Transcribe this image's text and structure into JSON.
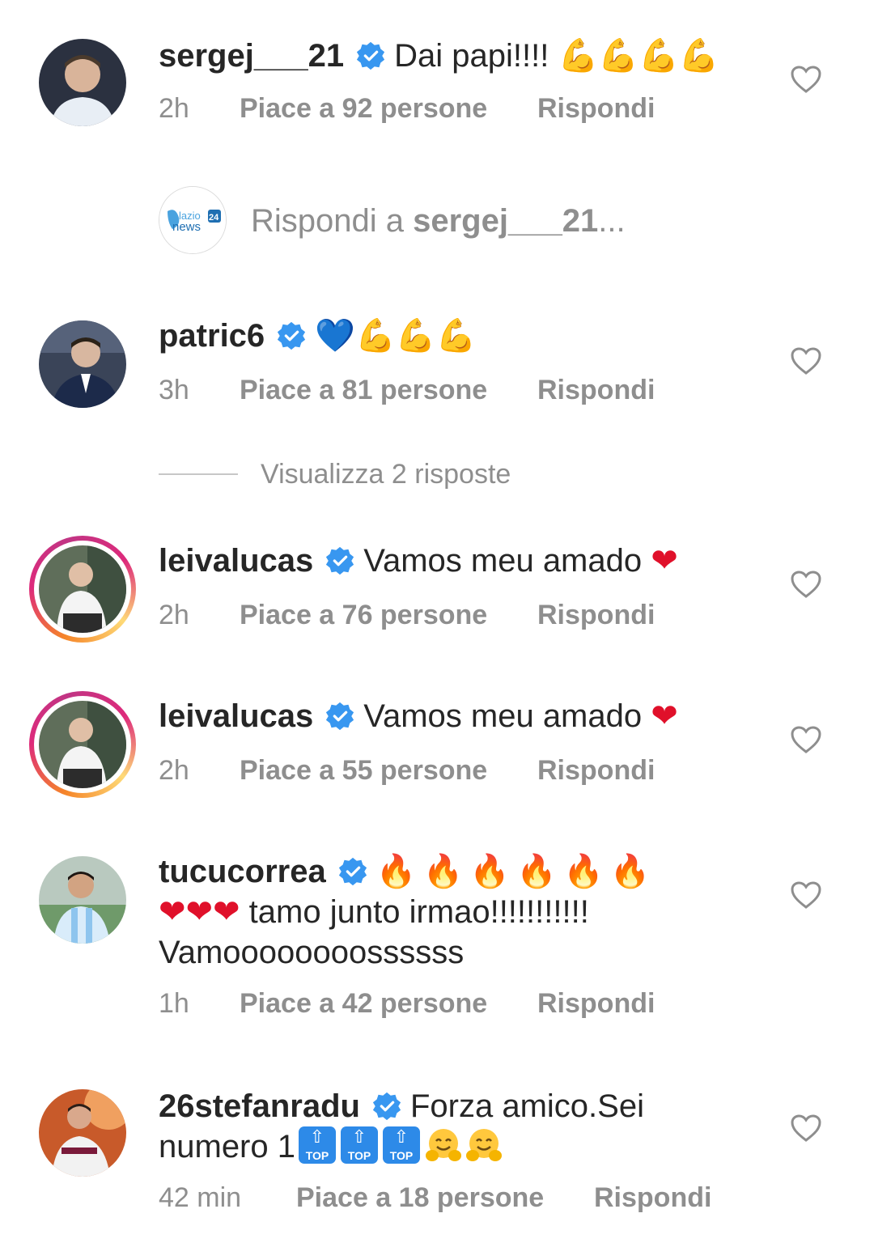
{
  "comments": [
    {
      "username": "sergej___21",
      "text": "Dai papi!!!!",
      "emojis": "💪💪💪💪",
      "time": "2h",
      "likes": "Piace a 92 persone",
      "reply": "Rispondi"
    },
    {
      "username": "patric6",
      "emojis": "💙💪💪💪",
      "time": "3h",
      "likes": "Piace a 81 persone",
      "reply": "Rispondi"
    },
    {
      "username": "leivalucas",
      "text": "Vamos meu amado",
      "emojis": "❤",
      "time": "2h",
      "likes": "Piace a 76 persone",
      "reply": "Rispondi"
    },
    {
      "username": "leivalucas",
      "text": "Vamos meu amado",
      "emojis": "❤",
      "time": "2h",
      "likes": "Piace a 55 persone",
      "reply": "Rispondi"
    },
    {
      "username": "tucucorrea",
      "emojis_fire": "🔥🔥🔥🔥🔥🔥",
      "emojis_hearts": "❤❤❤",
      "text_line2": "tamo junto irmao!!!!!!!!!!!",
      "text_line3": "Vamoooooooossssss",
      "time": "1h",
      "likes": "Piace a 42 persone",
      "reply": "Rispondi"
    },
    {
      "username": "26stefanradu",
      "text": "Forza amico.Sei",
      "text_line2": "numero 1",
      "top_badge_label": "TOP",
      "emojis_hug": "🤗🤗",
      "time": "42 min",
      "likes": "Piace a 18 persone",
      "reply": "Rispondi"
    }
  ],
  "reply_box": {
    "prefix": "Rispondi a ",
    "target": "sergej___21",
    "suffix": "...",
    "avatar_text": "lazio news 24"
  },
  "view_replies": "Visualizza 2 risposte",
  "colors": {
    "text": "#262626",
    "secondary": "#8e8e8e",
    "verified": "#3897f0",
    "story_ring": "#dd2a7b"
  }
}
